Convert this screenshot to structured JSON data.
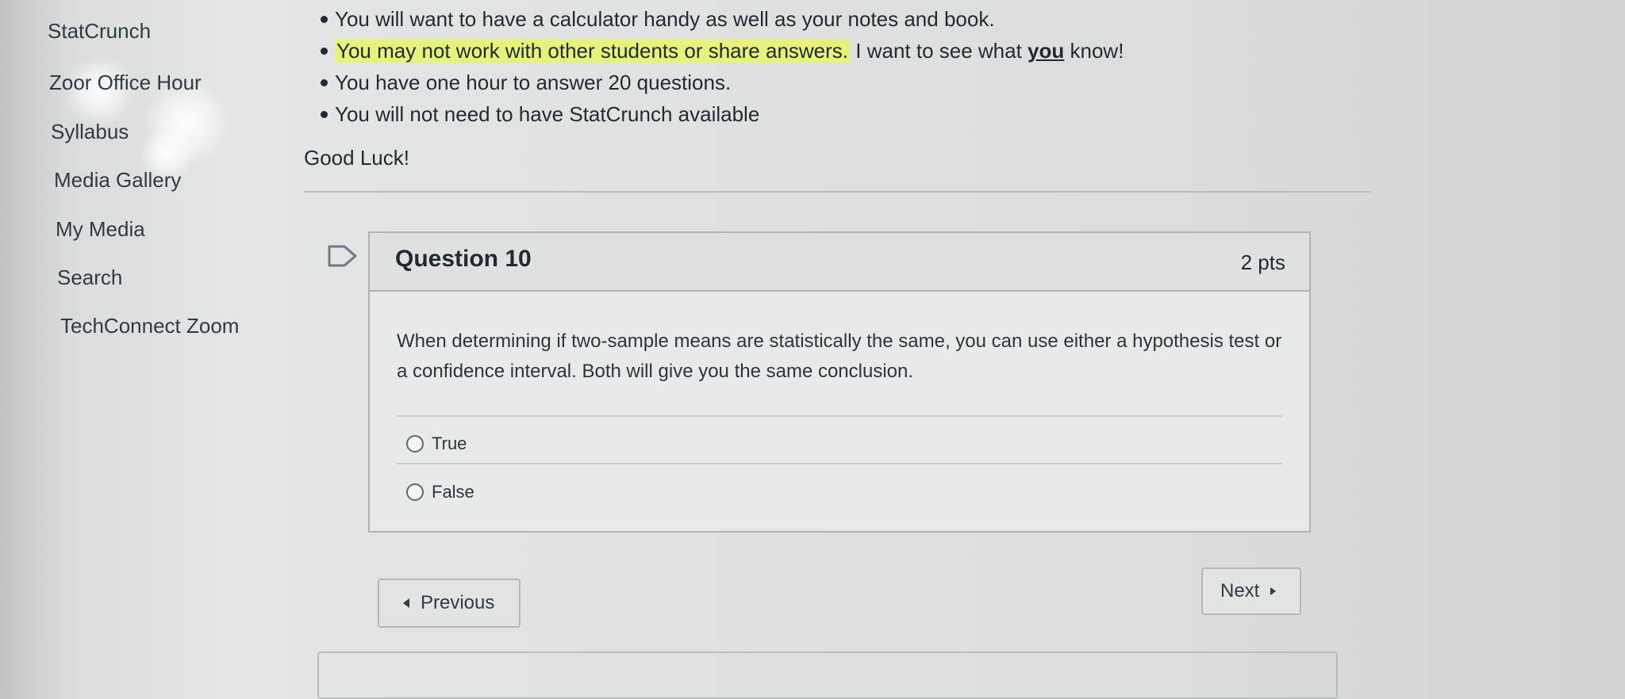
{
  "course_nav": {
    "items": [
      {
        "label": "StatCrunch"
      },
      {
        "label": "Zoor  Office Hour"
      },
      {
        "label": "Syllabus"
      },
      {
        "label": "Media Gallery"
      },
      {
        "label": "My Media"
      },
      {
        "label": "Search"
      },
      {
        "label": "TechConnect Zoom"
      }
    ]
  },
  "instructions": {
    "bullets": [
      {
        "text": "You will want to have a calculator handy as well as your notes and book."
      },
      {
        "highlighted": "You may not work with other students or share answers.",
        "before_em": " I want to see what ",
        "em": "you",
        "after_em": " know!"
      },
      {
        "text": "You have one hour to answer 20 questions."
      },
      {
        "text": "You will not need to have StatCrunch available"
      }
    ],
    "closing": "Good Luck!"
  },
  "question": {
    "title": "Question 10",
    "points": "2 pts",
    "text": "When determining if two-sample means are statistically the same, you can use either a hypothesis test or a confidence interval.  Both will give you the same conclusion.",
    "answers": [
      {
        "label": "True"
      },
      {
        "label": "False"
      }
    ]
  },
  "navigation": {
    "previous_label": "Previous",
    "next_label": "Next"
  }
}
